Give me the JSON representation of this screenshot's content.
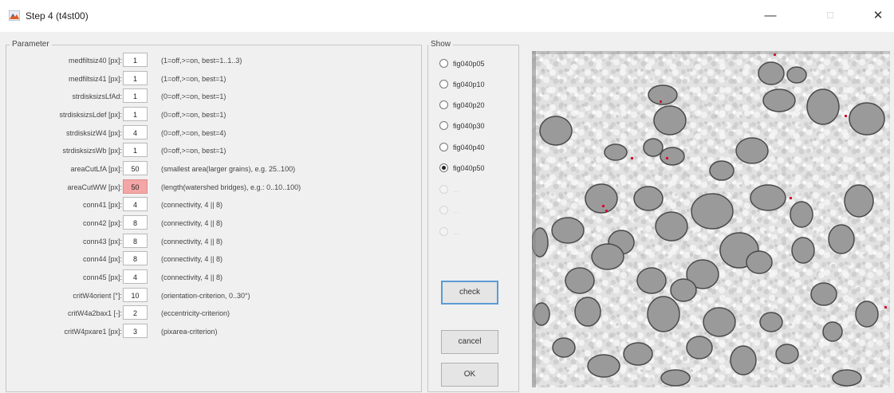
{
  "window": {
    "title": "Step 4 (t4st00)",
    "minimize_glyph": "—",
    "maximize_glyph": "☐",
    "close_glyph": "✕"
  },
  "parameter_panel": {
    "title": "Parameter",
    "rows": [
      {
        "label": "medfiltsiz40 [px]:",
        "value": "1",
        "desc": "(1=off,>=on, best=1..1..3)",
        "highlight": false
      },
      {
        "label": "medfiltsiz41 [px]:",
        "value": "1",
        "desc": "(1=off,>=on, best=1)",
        "highlight": false
      },
      {
        "label": "strdisksizsLfAd:",
        "value": "1",
        "desc": "(0=off,>=on, best=1)",
        "highlight": false
      },
      {
        "label": "strdisksizsLdef [px]:",
        "value": "1",
        "desc": "(0=off,>=on, best=1)",
        "highlight": false
      },
      {
        "label": "strdisksizW4 [px]:",
        "value": "4",
        "desc": "(0=off,>=on, best=4)",
        "highlight": false
      },
      {
        "label": "strdisksizsWb [px]:",
        "value": "1",
        "desc": "(0=off,>=on, best=1)",
        "highlight": false
      },
      {
        "label": "areaCutLfA [px]:",
        "value": "50",
        "desc": "(smallest area(larger grains), e.g. 25..100)",
        "highlight": false
      },
      {
        "label": "areaCutWW [px]:",
        "value": "50",
        "desc": "(length(watershed bridges), e.g.: 0..10..100)",
        "highlight": true
      },
      {
        "label": "conn41 [px]:",
        "value": "4",
        "desc": "(connectivity, 4 || 8)",
        "highlight": false
      },
      {
        "label": "conn42 [px]:",
        "value": "8",
        "desc": "(connectivity, 4 || 8)",
        "highlight": false
      },
      {
        "label": "conn43 [px]:",
        "value": "8",
        "desc": "(connectivity, 4 || 8)",
        "highlight": false
      },
      {
        "label": "conn44 [px]:",
        "value": "8",
        "desc": "(connectivity, 4 || 8)",
        "highlight": false
      },
      {
        "label": "conn45 [px]:",
        "value": "4",
        "desc": "(connectivity, 4 || 8)",
        "highlight": false
      },
      {
        "label": "critW4orient [°]:",
        "value": "10",
        "desc": "(orientation-criterion, 0..30°)",
        "highlight": false
      },
      {
        "label": "critW4a2bax1 [-]:",
        "value": "2",
        "desc": "(eccentricity-criterion)",
        "highlight": false
      },
      {
        "label": "critW4pxare1 [px]:",
        "value": "3",
        "desc": "(pixarea-criterion)",
        "highlight": false
      }
    ]
  },
  "show_panel": {
    "title": "Show",
    "options": [
      {
        "label": "fig040p05",
        "checked": false,
        "enabled": true
      },
      {
        "label": "fig040p10",
        "checked": false,
        "enabled": true
      },
      {
        "label": "fig040p20",
        "checked": false,
        "enabled": true
      },
      {
        "label": "fig040p30",
        "checked": false,
        "enabled": true
      },
      {
        "label": "fig040p40",
        "checked": false,
        "enabled": true
      },
      {
        "label": "fig040p50",
        "checked": true,
        "enabled": true
      },
      {
        "label": "...",
        "checked": false,
        "enabled": false
      },
      {
        "label": "...",
        "checked": false,
        "enabled": false
      },
      {
        "label": "...",
        "checked": false,
        "enabled": false
      }
    ],
    "check_label": "check",
    "cancel_label": "cancel",
    "ok_label": "OK"
  },
  "colors": {
    "highlight_input": "#f4a6a6",
    "grain_fill": "#9a9a9a",
    "grain_edge": "#4a4a4a",
    "bridge_marker": "#d01030",
    "focus_border": "#5b9bd5"
  },
  "icons": {
    "app": "matlab-figure-icon",
    "minimize": "minimize-icon",
    "maximize": "maximize-icon",
    "close": "close-icon"
  }
}
